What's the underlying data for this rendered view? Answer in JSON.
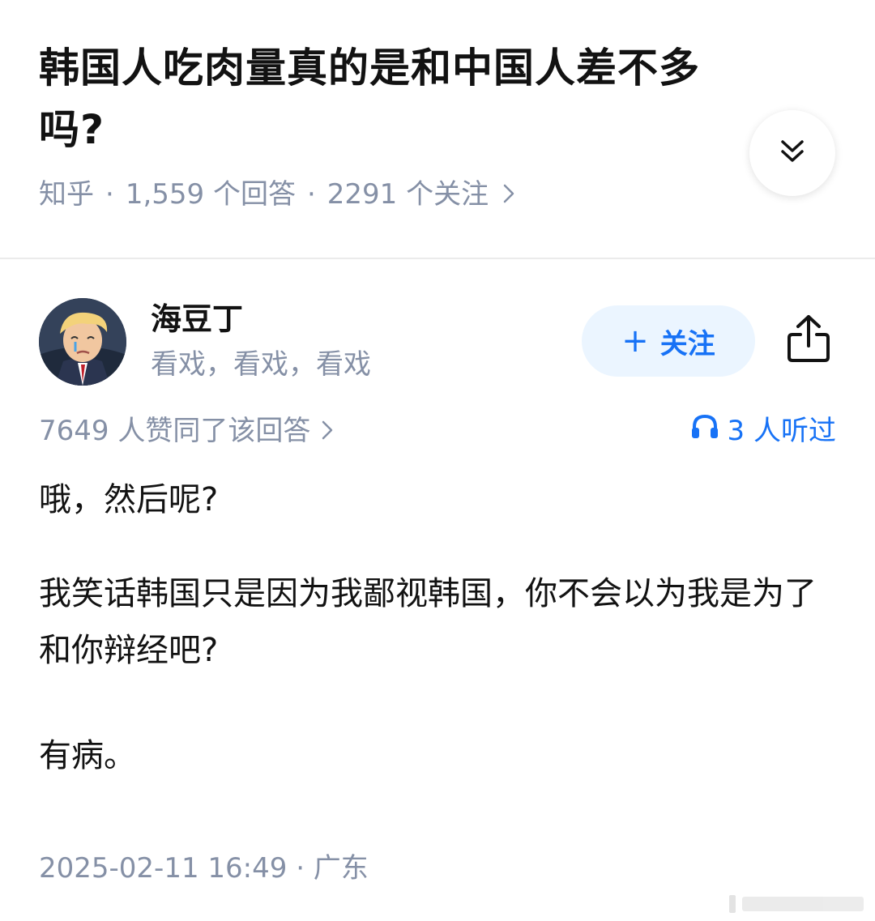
{
  "question": {
    "title": "韩国人吃肉量真的是和中国人差不多吗?",
    "source": "知乎",
    "separator": "·",
    "answer_count": "1,559 个回答",
    "follower_count": "2291 个关注",
    "expand_icon": "double-chevron-down-icon"
  },
  "answer": {
    "author": {
      "name": "海豆丁",
      "bio": "看戏，看戏，看戏"
    },
    "follow_label": "关注",
    "follow_plus": "+",
    "share_icon": "share-icon",
    "votes": "7649 人赞同了该回答",
    "listeners": "3 人听过",
    "paragraphs": [
      "哦，然后呢?",
      "我笑话韩国只是因为我鄙视韩国，你不会以为我是为了和你辩经吧?",
      "有病。"
    ],
    "timestamp": "2025-02-11 16:49 · 广东"
  },
  "colors": {
    "accent": "#1772f6",
    "accent_bg": "#ebf5ff",
    "muted": "#8590a6",
    "text": "#121212"
  }
}
